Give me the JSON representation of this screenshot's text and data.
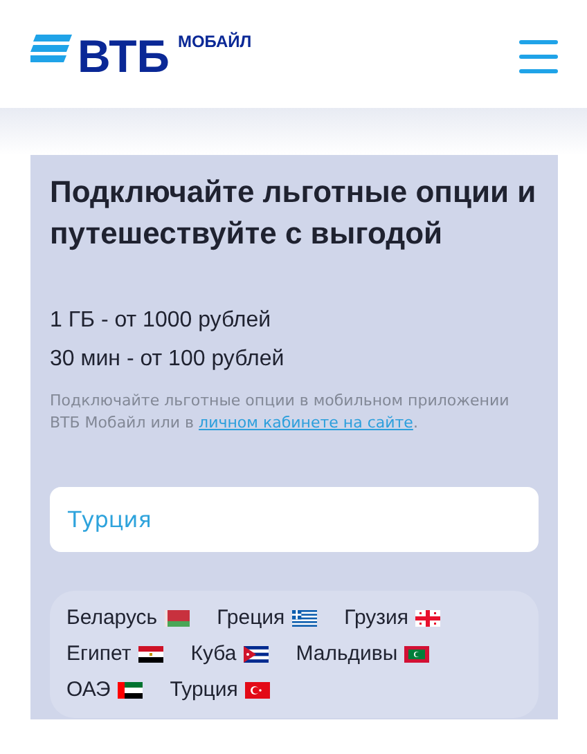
{
  "header": {
    "logo": "ВТБ",
    "logo_suffix": "МОБАЙЛ"
  },
  "promo": {
    "title": "Подключайте льготные опции и путешествуйте с выгодой",
    "offers": [
      "1 ГБ - от 1000 рублей",
      "30 мин - от 100 рублей"
    ],
    "note": "Подключайте льготные опции в мобильном приложении ВТБ Мобайл или в ",
    "note_link": "личном кабинете на сайте",
    "note_end": ".",
    "search": {
      "value": "Турция"
    },
    "countries": [
      {
        "name": "Беларусь",
        "kind": "belarus"
      },
      {
        "name": "Греция",
        "kind": "greece"
      },
      {
        "name": "Грузия",
        "kind": "georgia"
      },
      {
        "name": "Египет",
        "kind": "egypt"
      },
      {
        "name": "Куба",
        "kind": "cuba"
      },
      {
        "name": "Мальдивы",
        "kind": "maldives"
      },
      {
        "name": "ОАЭ",
        "kind": "uae"
      },
      {
        "name": "Турция",
        "kind": "turkey"
      }
    ]
  }
}
